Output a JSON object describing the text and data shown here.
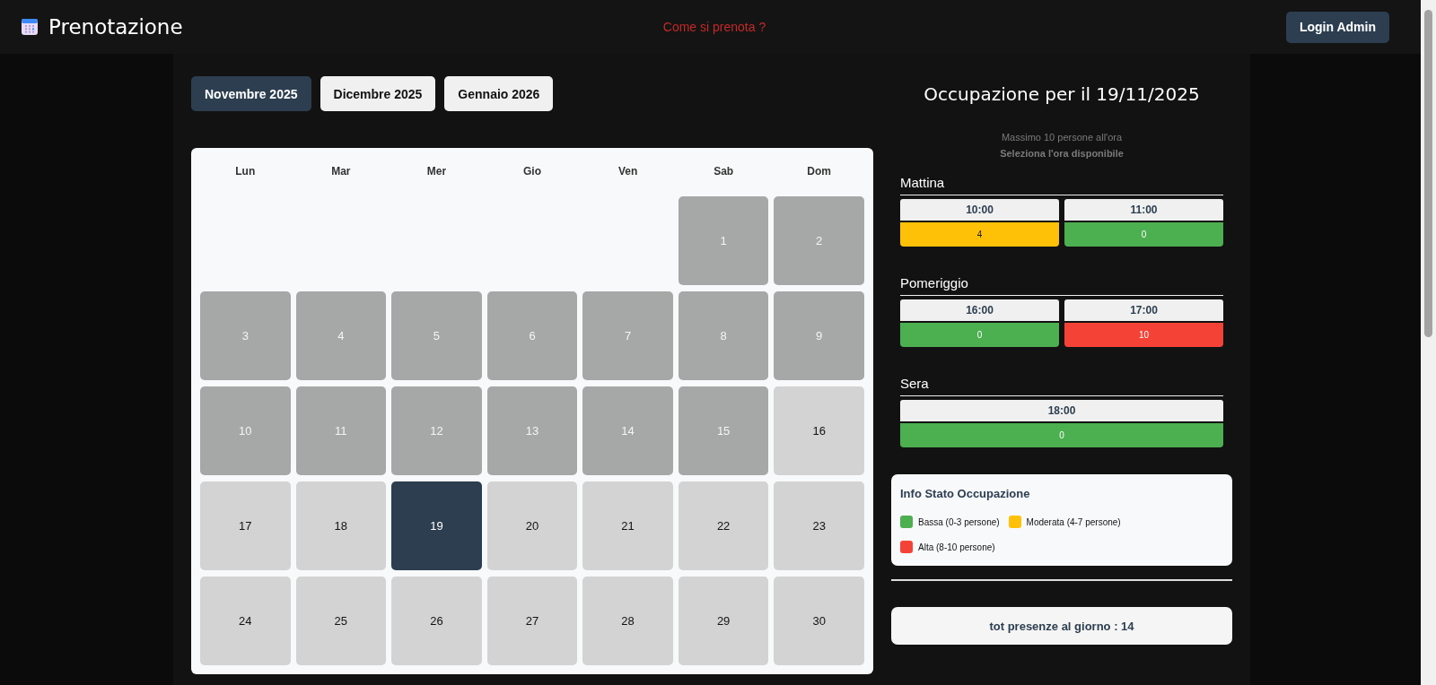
{
  "header": {
    "title": "Prenotazione",
    "help_link": "Come si prenota ?",
    "login_button": "Login Admin"
  },
  "months": [
    {
      "label": "Novembre 2025",
      "selected": true
    },
    {
      "label": "Dicembre 2025",
      "selected": false
    },
    {
      "label": "Gennaio 2026",
      "selected": false
    }
  ],
  "calendar": {
    "weekdays": [
      "Lun",
      "Mar",
      "Mer",
      "Gio",
      "Ven",
      "Sab",
      "Dom"
    ],
    "days": [
      {
        "kind": "blank"
      },
      {
        "kind": "blank"
      },
      {
        "kind": "blank"
      },
      {
        "kind": "blank"
      },
      {
        "kind": "blank"
      },
      {
        "kind": "day",
        "label": "1",
        "disabled": true,
        "selected": false
      },
      {
        "kind": "day",
        "label": "2",
        "disabled": true,
        "selected": false
      },
      {
        "kind": "day",
        "label": "3",
        "disabled": true,
        "selected": false
      },
      {
        "kind": "day",
        "label": "4",
        "disabled": true,
        "selected": false
      },
      {
        "kind": "day",
        "label": "5",
        "disabled": true,
        "selected": false
      },
      {
        "kind": "day",
        "label": "6",
        "disabled": true,
        "selected": false
      },
      {
        "kind": "day",
        "label": "7",
        "disabled": true,
        "selected": false
      },
      {
        "kind": "day",
        "label": "8",
        "disabled": true,
        "selected": false
      },
      {
        "kind": "day",
        "label": "9",
        "disabled": true,
        "selected": false
      },
      {
        "kind": "day",
        "label": "10",
        "disabled": true,
        "selected": false
      },
      {
        "kind": "day",
        "label": "11",
        "disabled": true,
        "selected": false
      },
      {
        "kind": "day",
        "label": "12",
        "disabled": true,
        "selected": false
      },
      {
        "kind": "day",
        "label": "13",
        "disabled": true,
        "selected": false
      },
      {
        "kind": "day",
        "label": "14",
        "disabled": true,
        "selected": false
      },
      {
        "kind": "day",
        "label": "15",
        "disabled": true,
        "selected": false
      },
      {
        "kind": "day",
        "label": "16",
        "disabled": false,
        "selected": false
      },
      {
        "kind": "day",
        "label": "17",
        "disabled": false,
        "selected": false
      },
      {
        "kind": "day",
        "label": "18",
        "disabled": false,
        "selected": false
      },
      {
        "kind": "day",
        "label": "19",
        "disabled": false,
        "selected": true
      },
      {
        "kind": "day",
        "label": "20",
        "disabled": false,
        "selected": false
      },
      {
        "kind": "day",
        "label": "21",
        "disabled": false,
        "selected": false
      },
      {
        "kind": "day",
        "label": "22",
        "disabled": false,
        "selected": false
      },
      {
        "kind": "day",
        "label": "23",
        "disabled": false,
        "selected": false
      },
      {
        "kind": "day",
        "label": "24",
        "disabled": false,
        "selected": false
      },
      {
        "kind": "day",
        "label": "25",
        "disabled": false,
        "selected": false
      },
      {
        "kind": "day",
        "label": "26",
        "disabled": false,
        "selected": false
      },
      {
        "kind": "day",
        "label": "27",
        "disabled": false,
        "selected": false
      },
      {
        "kind": "day",
        "label": "28",
        "disabled": false,
        "selected": false
      },
      {
        "kind": "day",
        "label": "29",
        "disabled": false,
        "selected": false
      },
      {
        "kind": "day",
        "label": "30",
        "disabled": false,
        "selected": false
      }
    ]
  },
  "occupancy": {
    "title": "Occupazione per il 19/11/2025",
    "note": "Massimo 10 persone all'ora",
    "instruction": "Seleziona l'ora disponibile",
    "sections": [
      {
        "name": "Mattina",
        "slots": [
          {
            "time": "10:00",
            "count": "4",
            "color": "#ffc107"
          },
          {
            "time": "11:00",
            "count": "0",
            "color": "#4caf50"
          }
        ]
      },
      {
        "name": "Pomeriggio",
        "slots": [
          {
            "time": "16:00",
            "count": "0",
            "color": "#4caf50"
          },
          {
            "time": "17:00",
            "count": "10",
            "color": "#f44336"
          }
        ]
      },
      {
        "name": "Sera",
        "slots": [
          {
            "time": "18:00",
            "count": "0",
            "color": "#4caf50"
          }
        ]
      }
    ]
  },
  "legend": {
    "title": "Info Stato Occupazione",
    "items": [
      {
        "label": "Bassa (0-3 persone)",
        "color": "#4caf50"
      },
      {
        "label": "Moderata (4-7 persone)",
        "color": "#ffc107"
      },
      {
        "label": "Alta (8-10 persone)",
        "color": "#f44336"
      }
    ]
  },
  "total": "tot presenze al giorno : 14"
}
